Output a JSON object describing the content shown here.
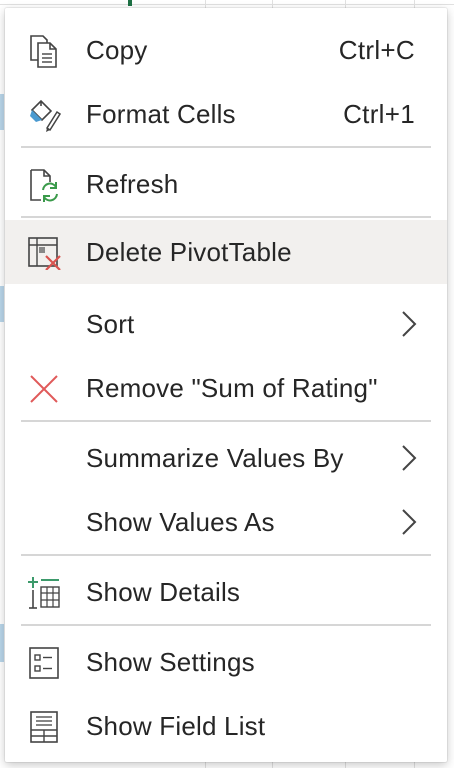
{
  "menu": {
    "items": [
      {
        "label": "Copy",
        "shortcut": "Ctrl+C",
        "icon": "copy-icon"
      },
      {
        "label": "Format Cells",
        "shortcut": "Ctrl+1",
        "icon": "format-cells-icon"
      },
      {
        "label": "Refresh",
        "icon": "refresh-icon"
      },
      {
        "label": "Delete PivotTable",
        "icon": "delete-pivottable-icon",
        "highlighted": true
      },
      {
        "label": "Sort",
        "has_submenu": true
      },
      {
        "label": "Remove \"Sum of Rating\"",
        "icon": "remove-icon"
      },
      {
        "label": "Summarize Values By",
        "has_submenu": true
      },
      {
        "label": "Show Values As",
        "has_submenu": true
      },
      {
        "label": "Show Details",
        "icon": "show-details-icon"
      },
      {
        "label": "Show Settings",
        "icon": "show-settings-icon"
      },
      {
        "label": "Show Field List",
        "icon": "field-list-icon"
      }
    ]
  },
  "colors": {
    "menu_background": "#ffffff",
    "highlight": "#f2f0ee",
    "text": "#262626",
    "separator": "#d6d6d6",
    "remove_icon": "#e05a5a",
    "refresh_arrow": "#3a9a4a",
    "details_icon": "#3c9a6b",
    "delete_cross": "#d9534f"
  }
}
